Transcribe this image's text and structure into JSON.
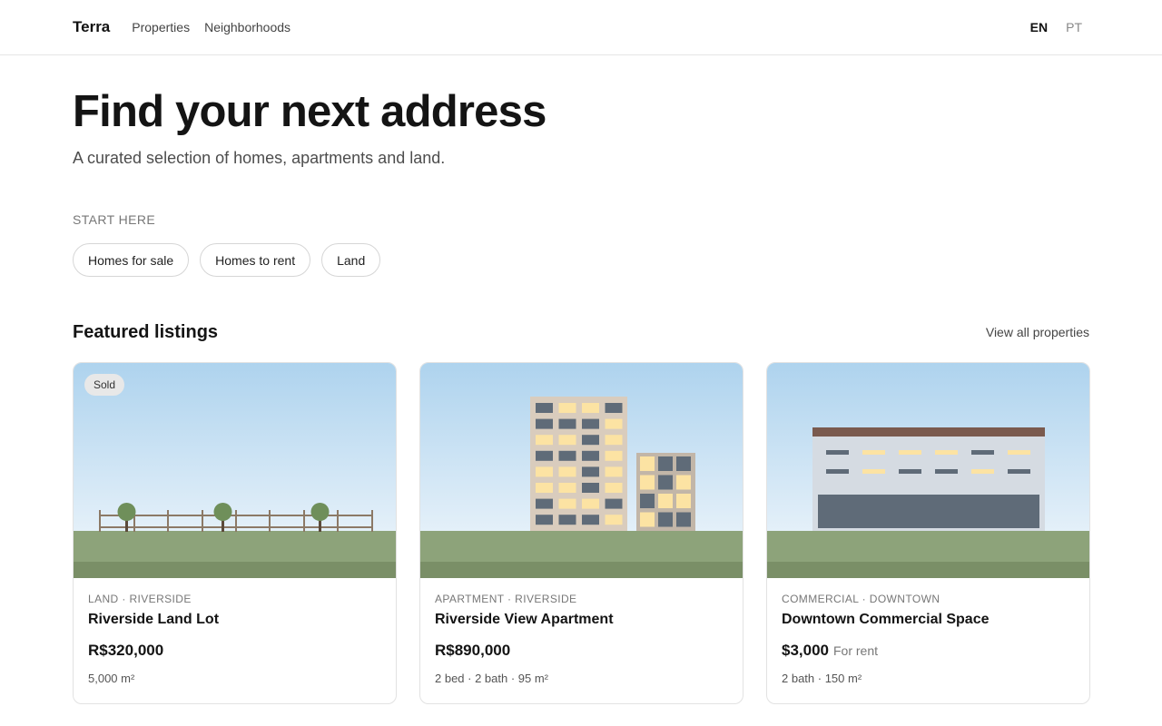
{
  "header": {
    "brand": "Terra",
    "nav": [
      "Properties",
      "Neighborhoods"
    ],
    "languages": [
      {
        "label": "EN",
        "active": true
      },
      {
        "label": "PT",
        "active": false
      }
    ]
  },
  "hero": {
    "title": "Find your next address",
    "subtitle": "A curated selection of homes, apartments and land."
  },
  "start": {
    "label": "START HERE",
    "chips": [
      "Homes for sale",
      "Homes to rent",
      "Land"
    ]
  },
  "featured": {
    "title": "Featured listings",
    "view_all": "View all properties",
    "listings": [
      {
        "badge": "Sold",
        "kicker": "LAND · RIVERSIDE",
        "title": "Riverside Land Lot",
        "price": "R$320,000",
        "price_note": "",
        "meta": "5,000 m²",
        "illustration": "land-lot-illustration"
      },
      {
        "badge": "",
        "kicker": "APARTMENT · RIVERSIDE",
        "title": "Riverside View Apartment",
        "price": "R$890,000",
        "price_note": "",
        "meta": "2 bed · 2 bath · 95 m²",
        "illustration": "apartment-building-illustration"
      },
      {
        "badge": "",
        "kicker": "COMMERCIAL · DOWNTOWN",
        "title": "Downtown Commercial Space",
        "price": "$3,000",
        "price_note": "For rent",
        "meta": "2 bath · 150 m²",
        "illustration": "commercial-building-illustration"
      }
    ]
  },
  "colors": {
    "sky_top": "#aed3ee",
    "sky_bottom": "#e4f0f9",
    "grass": "#8da37a",
    "grass_dark": "#7a8f67",
    "window_dark": "#5f6b78",
    "window_lit": "#fce3a3"
  }
}
